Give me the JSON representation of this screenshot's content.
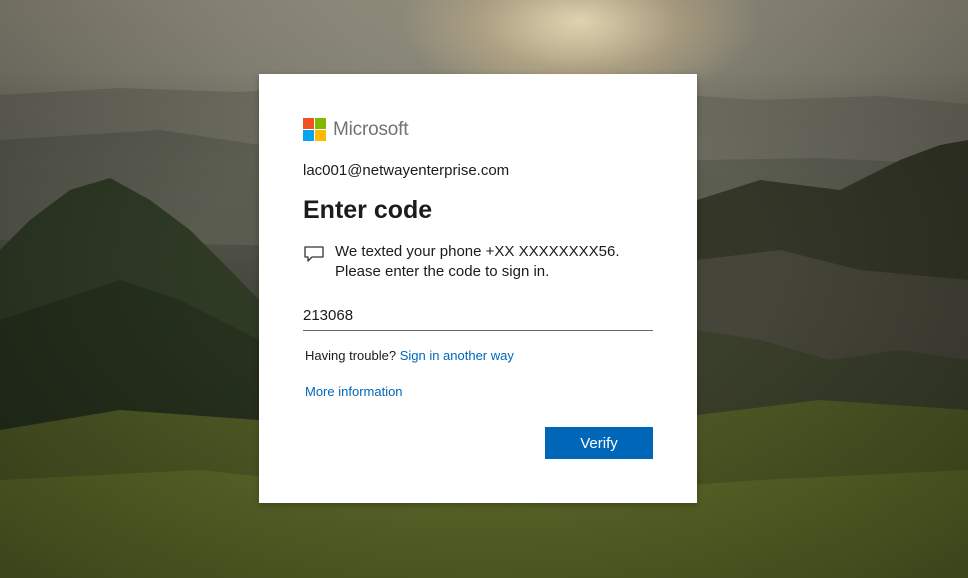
{
  "brand": {
    "name": "Microsoft",
    "colors": [
      "#f25022",
      "#7fba00",
      "#00a4ef",
      "#ffb900"
    ]
  },
  "account": {
    "email": "lac001@netwayenterprise.com"
  },
  "page": {
    "title": "Enter code"
  },
  "message": {
    "icon": "chat-bubble-icon",
    "text": "We texted your phone +XX XXXXXXXX56. Please enter the code to sign in."
  },
  "code_field": {
    "value": "213068",
    "placeholder": "Code"
  },
  "trouble": {
    "prefix": "Having trouble?",
    "link": "Sign in another way"
  },
  "more_info": {
    "link": "More information"
  },
  "verify_button": {
    "label": "Verify"
  },
  "accent_color": "#0067b8"
}
